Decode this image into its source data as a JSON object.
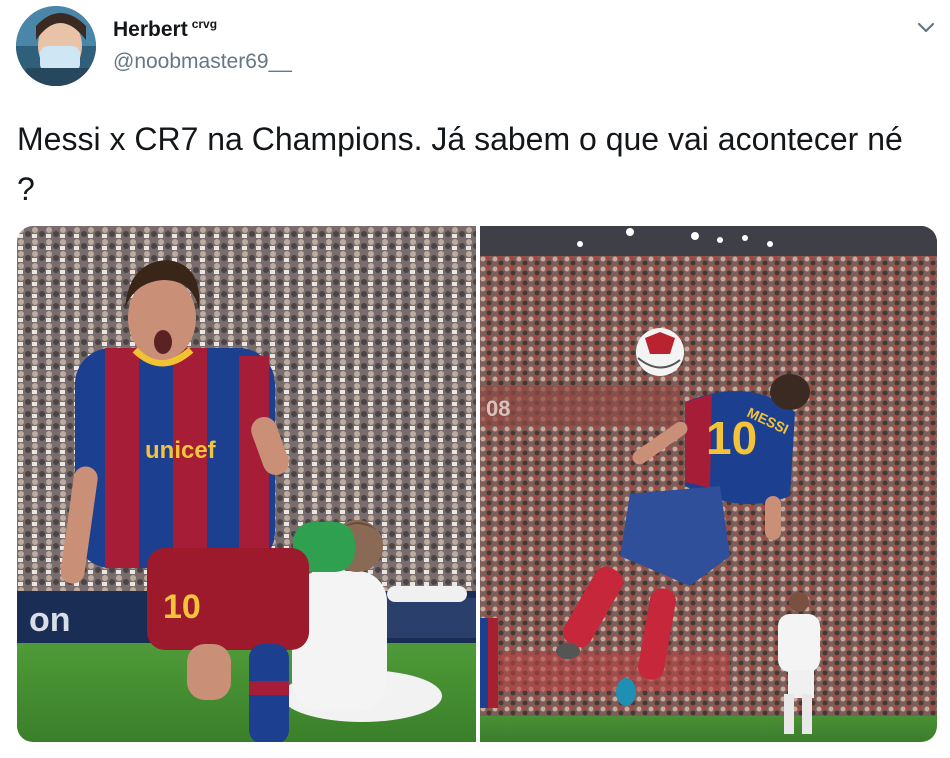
{
  "tweet": {
    "author_name": "Herbert",
    "author_badge": "crvg",
    "author_handle": "@noobmaster69__",
    "text": "Messi x CR7 na Champions. Já sabem o que vai acontecer né ?"
  },
  "media": {
    "left_photo": {
      "jersey_sponsor": "unicef",
      "shorts_number": "10",
      "board_text": "on"
    },
    "right_photo": {
      "jersey_name": "MESSI",
      "jersey_number": "10",
      "stand_text": "08"
    }
  },
  "icons": {
    "menu": "chevron-down-icon"
  },
  "colors": {
    "text": "#14171a",
    "secondary_text": "#657786",
    "barca_blue": "#1d3f8f",
    "barca_red": "#a51d36",
    "pitch": "#3f8a2f"
  }
}
